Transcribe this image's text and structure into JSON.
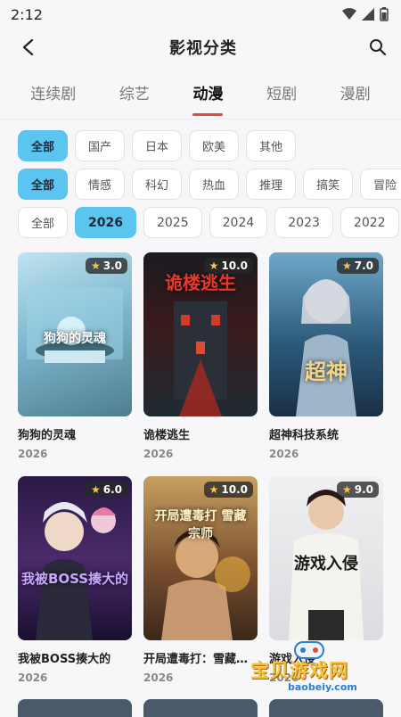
{
  "status": {
    "time": "2:12"
  },
  "header": {
    "title": "影视分类"
  },
  "tabs": [
    {
      "label": "连续剧",
      "active": false
    },
    {
      "label": "综艺",
      "active": false
    },
    {
      "label": "动漫",
      "active": true
    },
    {
      "label": "短剧",
      "active": false
    },
    {
      "label": "漫剧",
      "active": false
    }
  ],
  "filters": {
    "region": [
      "全部",
      "国产",
      "日本",
      "欧美",
      "其他"
    ],
    "genre": [
      "全部",
      "情感",
      "科幻",
      "热血",
      "推理",
      "搞笑",
      "冒险"
    ],
    "year": [
      "全部",
      "2026",
      "2025",
      "2024",
      "2023",
      "2022"
    ],
    "selected": {
      "region": 0,
      "genre": 0,
      "year": 1
    }
  },
  "items": [
    {
      "title": "狗狗的灵魂",
      "year": "2026",
      "rating": "3.0",
      "poster_text": "狗狗的灵魂"
    },
    {
      "title": "诡楼逃生",
      "year": "2026",
      "rating": "10.0",
      "poster_text": "诡楼逃生"
    },
    {
      "title": "超神科技系统",
      "year": "2026",
      "rating": "7.0",
      "poster_text": "超神"
    },
    {
      "title": "我被BOSS揍大的",
      "year": "2026",
      "rating": "6.0",
      "poster_text": "我被BOSS揍大的"
    },
    {
      "title": "开局遭毒打：雪藏宗师",
      "year": "2026",
      "rating": "10.0",
      "poster_text": "开局遭毒打 雪藏宗师"
    },
    {
      "title": "游戏入侵",
      "year": "2026",
      "rating": "9.0",
      "poster_text": "游戏入侵"
    }
  ],
  "watermark": {
    "text": "宝贝游戏网",
    "url": "baobeiy.com"
  },
  "colors": {
    "accent": "#5bc4ef",
    "tab_indicator": "#e24a3c",
    "star": "#f5c64a"
  }
}
